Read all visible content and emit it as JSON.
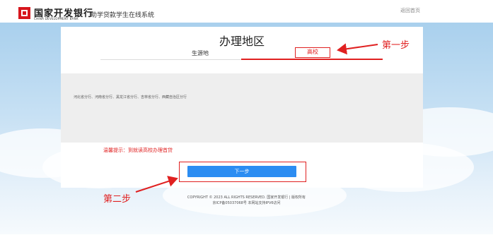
{
  "header": {
    "logo_cn": "国家开发银行",
    "logo_en": "CHINA DEVELOPMENT BANK",
    "system_title": "助学贷款学生在线系统",
    "back_link": "返回首页"
  },
  "card": {
    "title": "办理地区",
    "tabs": [
      {
        "label": "生源地",
        "active": false
      },
      {
        "label": "高校",
        "active": true
      }
    ],
    "branch_list": "河北省分行、河南省分行、黑龙江省分行、吉林省分行、西藏自治区分行",
    "notice": "温馨提示：到就读高校办理首贷",
    "next_button": "下一步"
  },
  "annotations": {
    "step1": "第一步",
    "step2": "第二步",
    "color": "#e02020"
  },
  "footer": {
    "copyright": "COPYRIGHT © 2023 ALL RIGHTS RESERVED. 国家开发银行 | 版权所有",
    "icp": "京ICP备05037068号 本网站支持IPV6访问"
  },
  "colors": {
    "brand_red": "#d7161d",
    "button_blue": "#2c8df2",
    "background_sky": "#c8e1f4"
  }
}
